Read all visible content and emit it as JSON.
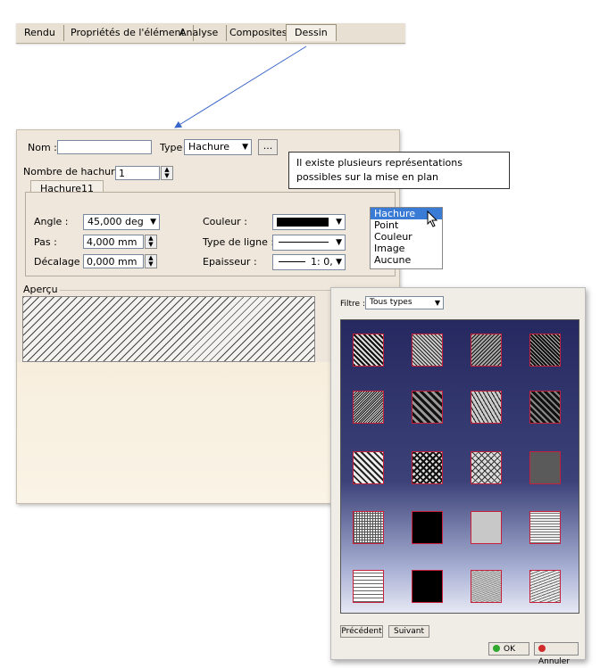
{
  "tabs": [
    "Rendu",
    "Propriétés de l'élément",
    "Analyse",
    "Composites",
    "Dessin"
  ],
  "form": {
    "nom_label": "Nom :",
    "nom_value": "",
    "type_label": "Type :",
    "type_value": "Hachure",
    "more_button": "...",
    "nombre_label": "Nombre de hachures :",
    "nombre_value": "1",
    "inner_tab": "Hachure11",
    "angle_label": "Angle :",
    "angle_value": "45,000 deg",
    "pas_label": "Pas :",
    "pas_value": "4,000 mm",
    "decalage_label": "Décalage :",
    "decalage_value": "0,000 mm",
    "couleur_label": "Couleur :",
    "type_ligne_label": "Type de ligne :",
    "epaisseur_label": "Epaisseur :",
    "epaisseur_value": "1: 0,",
    "apercu_label": "Aperçu"
  },
  "callout": "Il existe plusieurs représentations possibles sur la mise en plan",
  "type_options": [
    "Hachure",
    "Point",
    "Couleur",
    "Image",
    "Aucune"
  ],
  "dialog": {
    "filter_label": "Filtre :",
    "filter_value": "Tous types",
    "precedent": "Précédent",
    "suivant": "Suivant",
    "ok": "OK",
    "annuler": "Annuler"
  },
  "colors": {
    "panel": "#efe7dc",
    "grid_top": "#262960",
    "tile_border": "#c8203a",
    "selection": "#3a7bd5"
  }
}
